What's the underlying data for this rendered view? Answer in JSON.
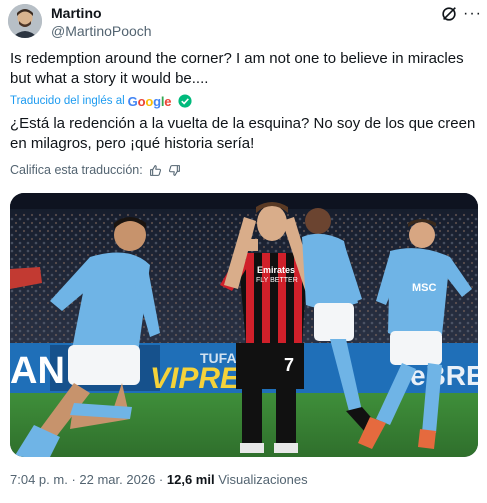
{
  "author": {
    "name": "Martino",
    "handle": "@MartinoPooch"
  },
  "post": {
    "original_text": "Is redemption around the corner? I am not one to believe in miracles but what a story it would be....",
    "translated_by_label": "Traducido del inglés al",
    "translator_brand": "Google",
    "translated_text": "¿Está la redención a la vuelta de la esquina? No soy de los que creen en milagros, pero ¡qué historia sería!",
    "rate_translation_label": "Califica esta traducción:"
  },
  "media": {
    "ad_board_texts": [
      "AN",
      "VIPREN",
      "TUFAN",
      "eBRE"
    ],
    "player_number": "7",
    "sponsor_text": "Emirates\nFLY BETTER",
    "sponsor_light": "MSC"
  },
  "footer": {
    "time": "7:04 p. m.",
    "separator": "·",
    "date": "22 mar. 2026",
    "views_count": "12,6 mil",
    "views_label": "Visualizaciones"
  },
  "icons": {
    "grok": "grok-icon",
    "more": "more-icon",
    "verified_check": "check-circle-icon",
    "thumb_up": "thumb-up-icon",
    "thumb_down": "thumb-down-icon"
  },
  "colors": {
    "link_blue": "#1d9bf0",
    "text_primary": "#0f1419",
    "text_secondary": "#536471",
    "check_green": "#00ba7c",
    "napoli_blue": "#6fb4e6",
    "milan_red": "#d0202a"
  }
}
